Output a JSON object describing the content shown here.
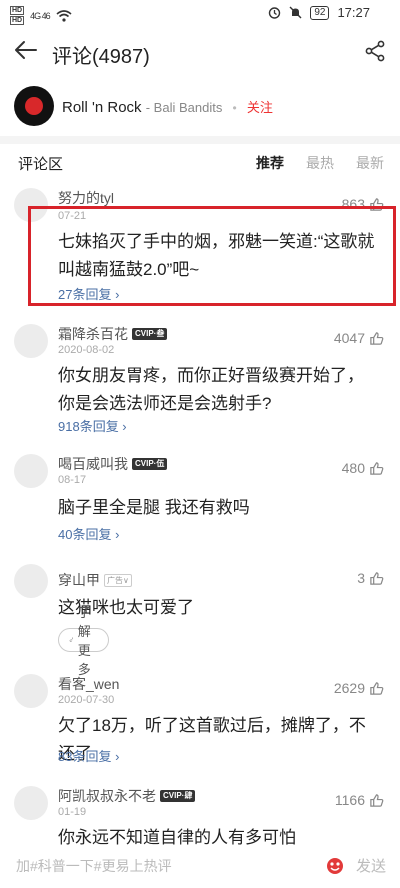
{
  "status_bar": {
    "left_tags": [
      "HD",
      "HD"
    ],
    "signal": "4G 46",
    "battery": "92",
    "time": "17:27",
    "icons": [
      "wifi-icon",
      "bell-mute-icon",
      "alarm-icon"
    ]
  },
  "header": {
    "title": "评论(4987)",
    "back_icon": "arrow-left-icon",
    "share_icon": "share-icon"
  },
  "song": {
    "name": "Roll 'n Rock",
    "artist": "- Bali Bandits",
    "dot": "•",
    "follow": "关注"
  },
  "section": {
    "title": "评论区",
    "tabs": [
      "推荐",
      "最热",
      "最新"
    ],
    "active_tab": "推荐"
  },
  "comments": [
    {
      "name": "努力的tyl",
      "date": "07-21",
      "likes": "863",
      "text": "七妹掐灭了手中的烟，邪魅一笑道:“这歌就叫越南猛鼓2.0”吧~",
      "reply": "27条回复 ›"
    },
    {
      "name": "霜降杀百花",
      "badge": "CVIP·叁",
      "date": "2020-08-02",
      "likes": "4047",
      "text": "你女朋友胃疼，而你正好晋级赛开始了，你是会选法师还是会选射手?",
      "reply": "918条回复 ›"
    },
    {
      "name": "喝百威叫我",
      "badge": "CVIP·伍",
      "date": "08-17",
      "likes": "480",
      "text": "脑子里全是腿 我还有救吗",
      "reply": "40条回复 ›"
    },
    {
      "name": "穿山甲",
      "badge": "广告∨",
      "likes": "3",
      "text": "这猫咪也太可爱了",
      "more": "了解更多"
    },
    {
      "name": "看客_wen",
      "date": "2020-07-30",
      "likes": "2629",
      "text": "欠了18万，听了这首歌过后，摊牌了，不还了",
      "reply": "83条回复 ›"
    },
    {
      "name": "阿凯叔叔永不老",
      "badge": "CVIP·肆",
      "date": "01-19",
      "likes": "1166",
      "text": "你永远不知道自律的人有多可怕"
    }
  ],
  "bottom_bar": {
    "placeholder": "加#科普一下#更易上热评",
    "send": "发送"
  },
  "colors": {
    "accent_red": "#e33333",
    "highlight_border": "#d8232a",
    "reply_link": "#4a6fa5"
  }
}
